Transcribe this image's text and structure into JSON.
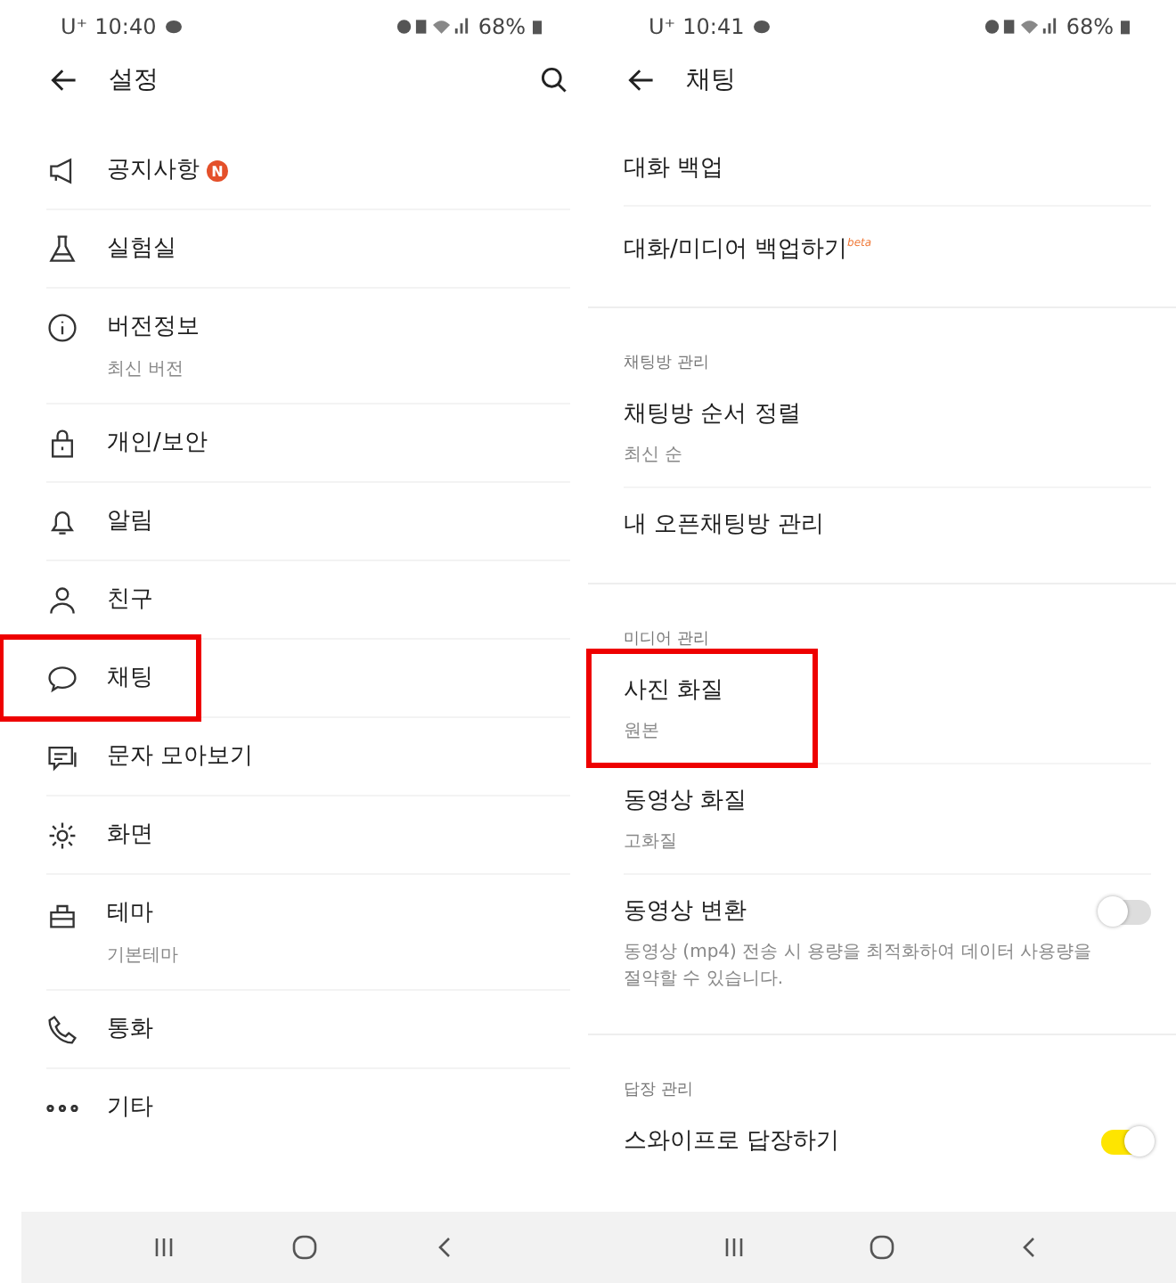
{
  "left": {
    "status": {
      "carrier": "U⁺",
      "time": "10:40",
      "battery": "68%"
    },
    "title": "설정",
    "items": [
      {
        "label": "공지사항",
        "badge": "N",
        "highlighted": false
      },
      {
        "label": "실험실",
        "highlighted": false
      },
      {
        "label": "버전정보",
        "sub": "최신 버전",
        "highlighted": false
      },
      {
        "label": "개인/보안",
        "highlighted": false
      },
      {
        "label": "알림",
        "highlighted": false
      },
      {
        "label": "친구",
        "highlighted": false
      },
      {
        "label": "채팅",
        "highlighted": true
      },
      {
        "label": "문자 모아보기",
        "highlighted": false
      },
      {
        "label": "화면",
        "highlighted": false
      },
      {
        "label": "테마",
        "sub": "기본테마",
        "highlighted": false
      },
      {
        "label": "통화",
        "highlighted": false
      },
      {
        "label": "기타",
        "highlighted": false
      }
    ]
  },
  "right": {
    "status": {
      "carrier": "U⁺",
      "time": "10:41",
      "battery": "68%"
    },
    "title": "채팅",
    "groups": [
      {
        "items": [
          {
            "kind": "item",
            "label": "대화 백업",
            "highlighted": false
          },
          {
            "kind": "item",
            "label": "대화/미디어 백업하기$^{beta}$",
            "highlighted": false
          }
        ]
      },
      {
        "label": "채팅방 관리",
        "items": [
          {
            "kind": "item",
            "label": "채팅방 순서 정렬",
            "sub": "최신 순",
            "highlighted": false
          },
          {
            "kind": "item",
            "label": "내 오픈채팅방 관리",
            "highlighted": false
          }
        ]
      },
      {
        "label": "미디어 관리",
        "items": [
          {
            "kind": "item",
            "label": "사진 화질",
            "sub": "원본",
            "highlighted": true
          },
          {
            "kind": "item",
            "label": "동영상 화질",
            "sub": "고화질",
            "highlighted": false
          },
          {
            "kind": "toggle",
            "label": "동영상 변환",
            "sub": "동영상 (mp4) 전송 시 용량을 최적화하여 데이터 사용량을 절약할 수 있습니다.",
            "on": false,
            "highlighted": false
          }
        ]
      },
      {
        "label": "답장 관리",
        "items": [
          {
            "kind": "toggle",
            "label": "스와이프로 답장하기",
            "on": true,
            "highlighted": false
          }
        ]
      }
    ]
  }
}
